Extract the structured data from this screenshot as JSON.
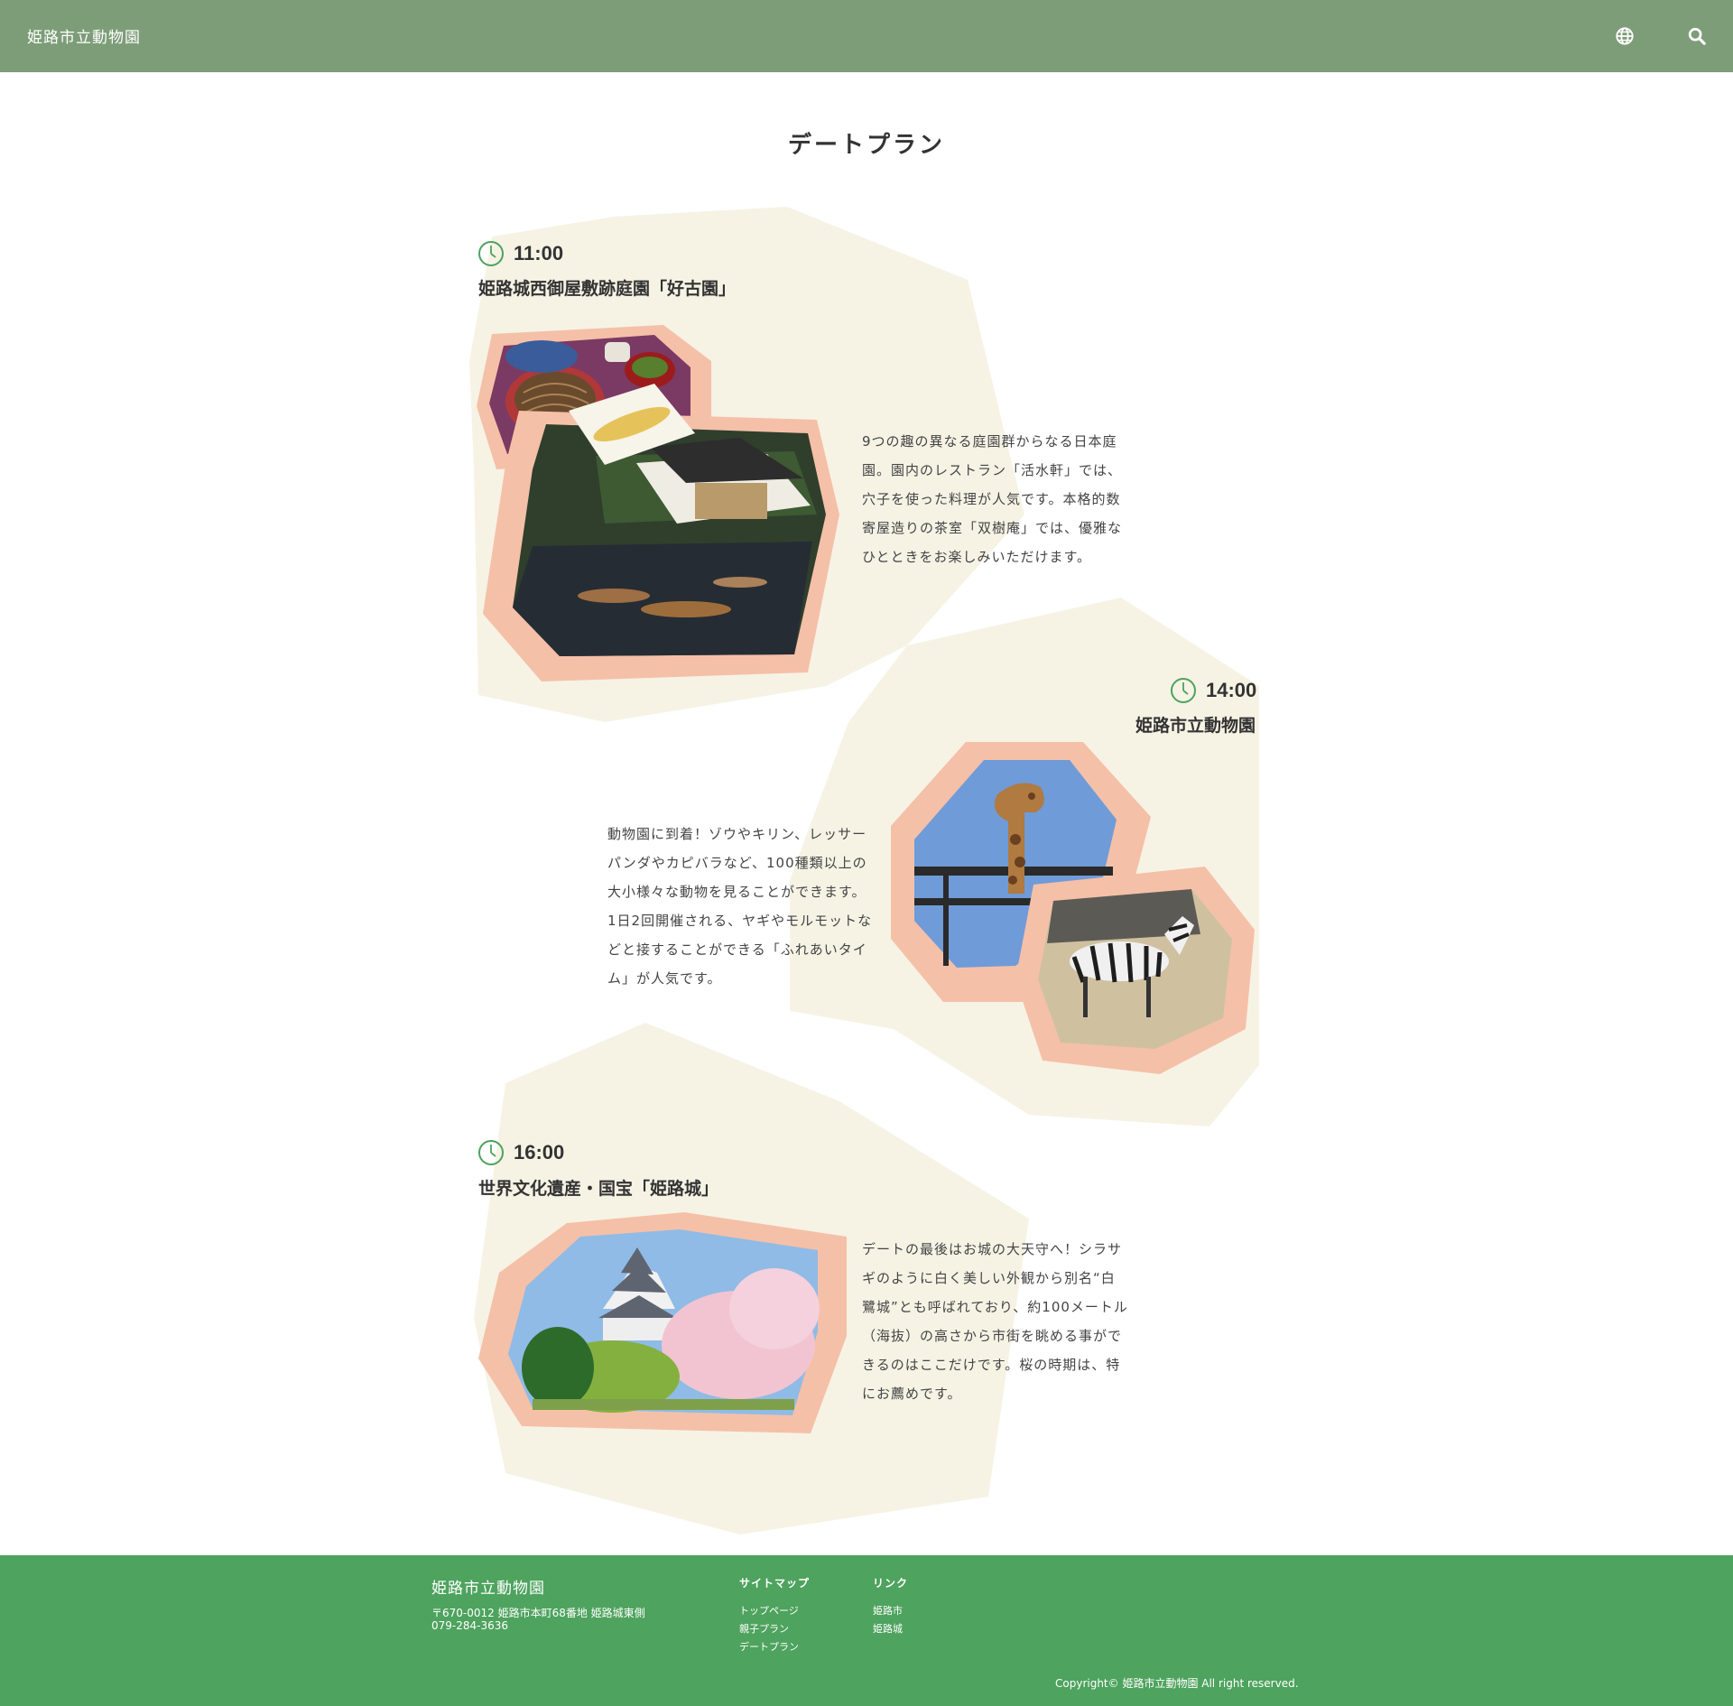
{
  "header": {
    "site_title": "姫路市立動物園",
    "globe_icon": "globe-icon",
    "search_icon": "search-icon"
  },
  "page_title": "デートプラン",
  "plans": [
    {
      "time": "11:00",
      "place": "姫路城西御屋敷跡庭園「好古園」",
      "desc_lines": [
        "9つの趣の異なる庭園群からなる日本庭",
        "園。園内のレストラン「活水軒」では、",
        "穴子を使った料理が人気です。本格的数",
        "寄屋造りの茶室「双樹庵」では、優雅な",
        "ひとときをお楽しみいただけます。"
      ]
    },
    {
      "time": "14:00",
      "place": "姫路市立動物園",
      "desc_lines": [
        "動物園に到着！ゾウやキリン、レッサー",
        "パンダやカピバラなど、100種類以上の",
        "大小様々な動物を見ることができます。",
        "1日2回開催される、ヤギやモルモットな",
        "どと接することができる「ふれあいタイ",
        "ム」が人気です。"
      ]
    },
    {
      "time": "16:00",
      "place": "世界文化遺産・国宝「姫路城」",
      "desc_lines": [
        "デートの最後はお城の大天守へ！シラサ",
        "ギのように白く美しい外観から別名“白",
        "鷺城”とも呼ばれており、約100メートル",
        "（海抜）の高さから市街を眺める事がで",
        "きるのはここだけです。桜の時期は、特",
        "にお薦めです。"
      ]
    }
  ],
  "footer": {
    "title": "姫路市立動物園",
    "address": "〒670-0012 姫路市本町68番地 姫路城東側",
    "phone": "079-284-3636",
    "sitemap_heading": "サイトマップ",
    "sitemap_links": [
      "トップページ",
      "親子プラン",
      "デートプラン"
    ],
    "links_heading": "リンク",
    "links": [
      "姫路市",
      "姫路城"
    ],
    "copyright": "Copyright© 姫路市立動物園 All right reserved."
  },
  "colors": {
    "header_bg": "#7d9d78",
    "footer_bg": "#4ea35e",
    "blob": "#f6f3e5",
    "photo_frame": "#f5c0a8",
    "clock": "#4ea35e"
  }
}
